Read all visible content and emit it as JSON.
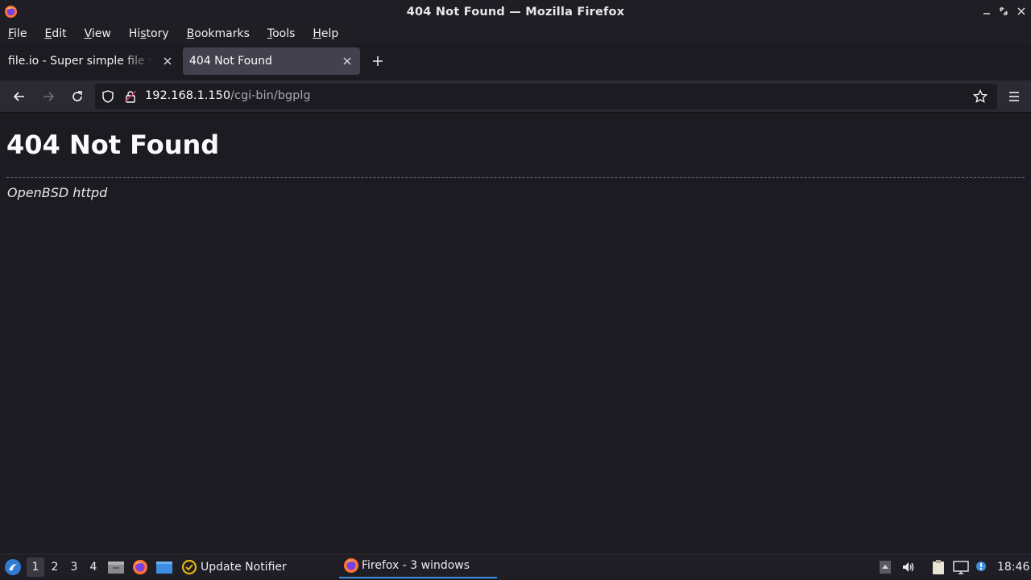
{
  "window": {
    "title": "404 Not Found — Mozilla Firefox"
  },
  "menu": {
    "items": [
      {
        "pre": "",
        "ul": "F",
        "post": "ile"
      },
      {
        "pre": "",
        "ul": "E",
        "post": "dit"
      },
      {
        "pre": "",
        "ul": "V",
        "post": "iew"
      },
      {
        "pre": "Hi",
        "ul": "s",
        "post": "tory"
      },
      {
        "pre": "",
        "ul": "B",
        "post": "ookmarks"
      },
      {
        "pre": "",
        "ul": "T",
        "post": "ools"
      },
      {
        "pre": "",
        "ul": "H",
        "post": "elp"
      }
    ]
  },
  "tabs": [
    {
      "title": "file.io - Super simple file sharing",
      "active": false
    },
    {
      "title": "404 Not Found",
      "active": true
    }
  ],
  "urlbar": {
    "host": "192.168.1.150",
    "path": "/cgi-bin/bgplg"
  },
  "page": {
    "heading": "404 Not Found",
    "server": "OpenBSD httpd"
  },
  "taskbar": {
    "workspaces": [
      "1",
      "2",
      "3",
      "4"
    ],
    "active_workspace": "1",
    "tasks": [
      {
        "label": "Update Notifier",
        "icon": "update-notifier-icon"
      },
      {
        "label": "Firefox - 3 windows",
        "icon": "firefox-icon",
        "active": true
      }
    ],
    "clock": "18:46"
  },
  "colors": {
    "accent": "#3d8de0",
    "background": "#1c1b22",
    "toolbar": "#2b2a33",
    "active_tab": "#42414d"
  }
}
